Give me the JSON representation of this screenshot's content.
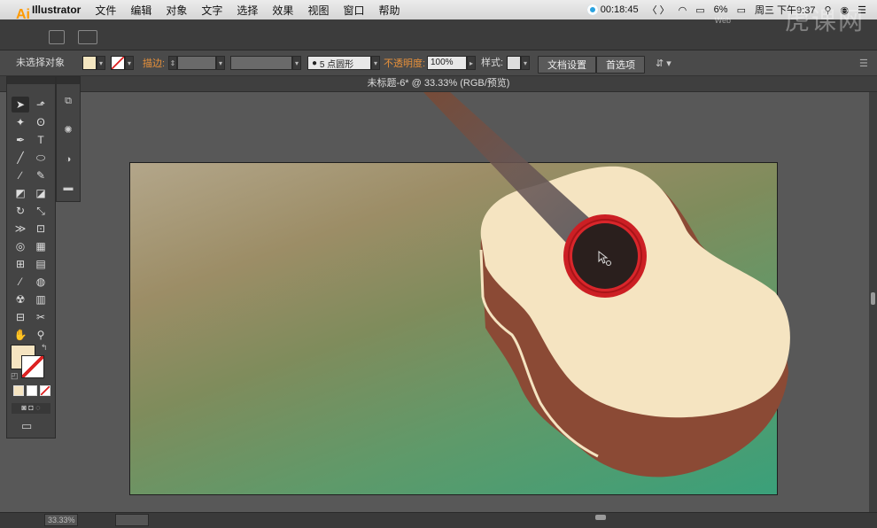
{
  "menubar": {
    "app": "Illustrator",
    "items": [
      "文件",
      "编辑",
      "对象",
      "文字",
      "选择",
      "效果",
      "视图",
      "窗口",
      "帮助"
    ],
    "recording_time": "00:18:45",
    "battery": "6%",
    "datetime": "周三 下午9:37"
  },
  "appbar": {
    "logo": "Ai",
    "watermark": "虎课网",
    "watermark_small": "Web"
  },
  "control": {
    "selection_label": "未选择对象",
    "stroke_label": "描边:",
    "brush_label": "5 点圆形",
    "opacity_label": "不透明度:",
    "opacity_value": "100%",
    "style_label": "样式:",
    "doc_settings": "文档设置",
    "preferences": "首选项",
    "fill_color": "#f4e6c0"
  },
  "document": {
    "title": "未标题-6* @ 33.33% (RGB/预览)"
  },
  "statusbar": {
    "zoom": "33.33%"
  },
  "colors": {
    "guitar_top": "#f5e4c1",
    "guitar_side": "#8b4a35",
    "soundhole_ring": "#cc1f24",
    "soundhole": "#2a1f1d",
    "neck": "#5f5a5f"
  }
}
